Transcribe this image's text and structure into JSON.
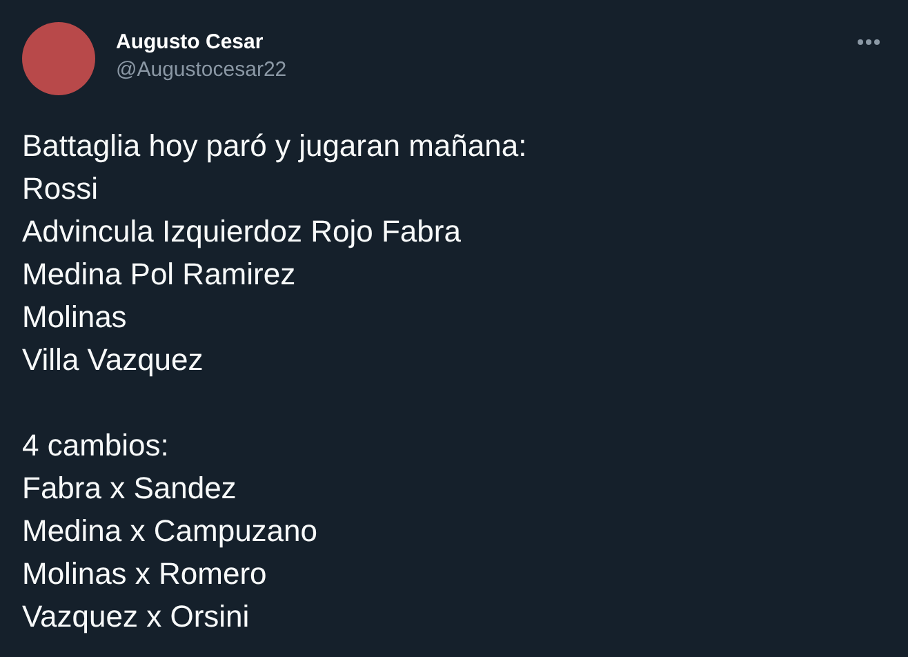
{
  "author": {
    "name": "Augusto Cesar",
    "handle": "@Augustocesar22"
  },
  "tweet": {
    "paragraphs": [
      [
        "Battaglia hoy paró y jugaran mañana:",
        "Rossi",
        "Advincula Izquierdoz Rojo Fabra",
        "Medina Pol Ramirez",
        "Molinas",
        "Villa Vazquez"
      ],
      [
        "4 cambios:",
        "Fabra x Sandez",
        "Medina x Campuzano",
        "Molinas x Romero",
        "Vazquez x Orsini"
      ]
    ]
  }
}
